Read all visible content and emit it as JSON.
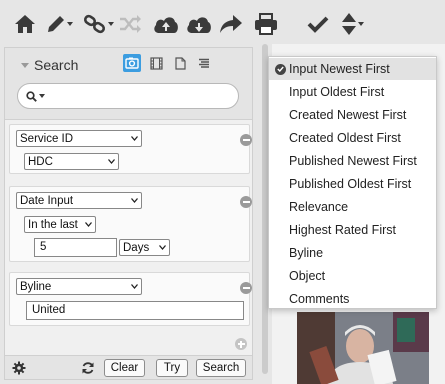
{
  "toolbar": {
    "icons": [
      "home-icon",
      "pencil-icon",
      "link-icon",
      "shuffle-icon",
      "cloud-upload-icon",
      "cloud-download-icon",
      "share-arrow-icon",
      "print-icon",
      "checkmark-icon",
      "sort-icon"
    ]
  },
  "search_panel": {
    "title": "Search",
    "type_icons": [
      "photo-icon",
      "video-icon",
      "document-icon",
      "text-icon"
    ],
    "active_type": "photo-icon",
    "search_box": {
      "value": "",
      "placeholder": ""
    },
    "criteria": [
      {
        "field": "Service ID",
        "value": "HDC"
      },
      {
        "field": "Date Input",
        "range": "In the last",
        "amount": "5",
        "unit": "Days"
      },
      {
        "field": "Byline",
        "value": "United"
      }
    ],
    "footer": {
      "clear_label": "Clear",
      "try_label": "Try",
      "search_label": "Search"
    }
  },
  "sort_menu": {
    "selected_index": 0,
    "items": [
      "Input Newest First",
      "Input Oldest First",
      "Created Newest First",
      "Created Oldest First",
      "Published Newest First",
      "Published Oldest First",
      "Relevance",
      "Highest Rated First",
      "Byline",
      "Object",
      "Comments"
    ]
  },
  "colors": {
    "accent": "#3c9de0",
    "toolbar_icon": "#3a3a3a",
    "menu_selected_bg": "#e2e2e2"
  }
}
